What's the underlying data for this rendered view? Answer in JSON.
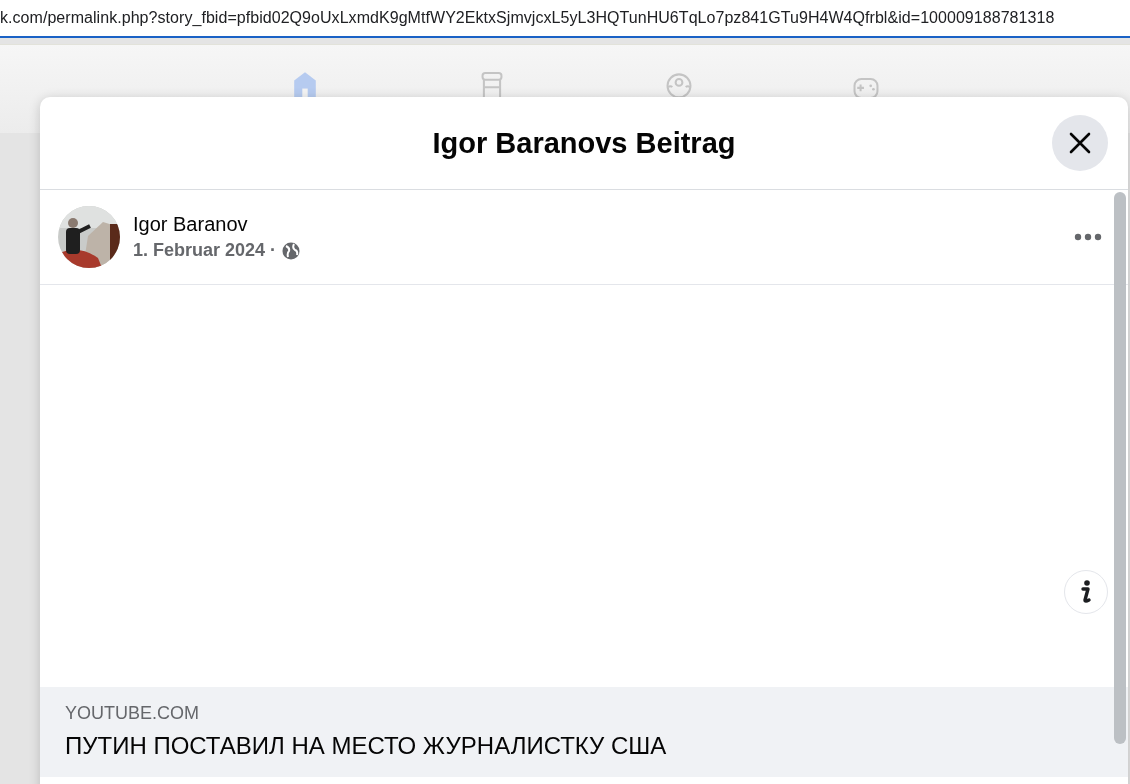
{
  "address_bar": {
    "url": "k.com/permalink.php?story_fbid=pfbid02Q9oUxLxmdK9gMtfWY2EktxSjmvjcxL5yL3HQTunHU6TqLo7pz841GTu9H4W4Qfrbl&id=100009188781318"
  },
  "nav": {
    "icons": [
      {
        "kind": "home",
        "selected": true
      },
      {
        "kind": "store",
        "selected": false
      },
      {
        "kind": "group",
        "selected": false
      },
      {
        "kind": "game",
        "selected": false
      }
    ]
  },
  "dialog": {
    "title": "Igor Baranovs Beitrag"
  },
  "post": {
    "author": "Igor Baranov",
    "date": "1. Februar 2024 ·"
  },
  "link_preview": {
    "domain": "YOUTUBE.COM",
    "title": "ПУТИН ПОСТАВИЛ НА МЕСТО ЖУРНАЛИСТКУ США"
  }
}
